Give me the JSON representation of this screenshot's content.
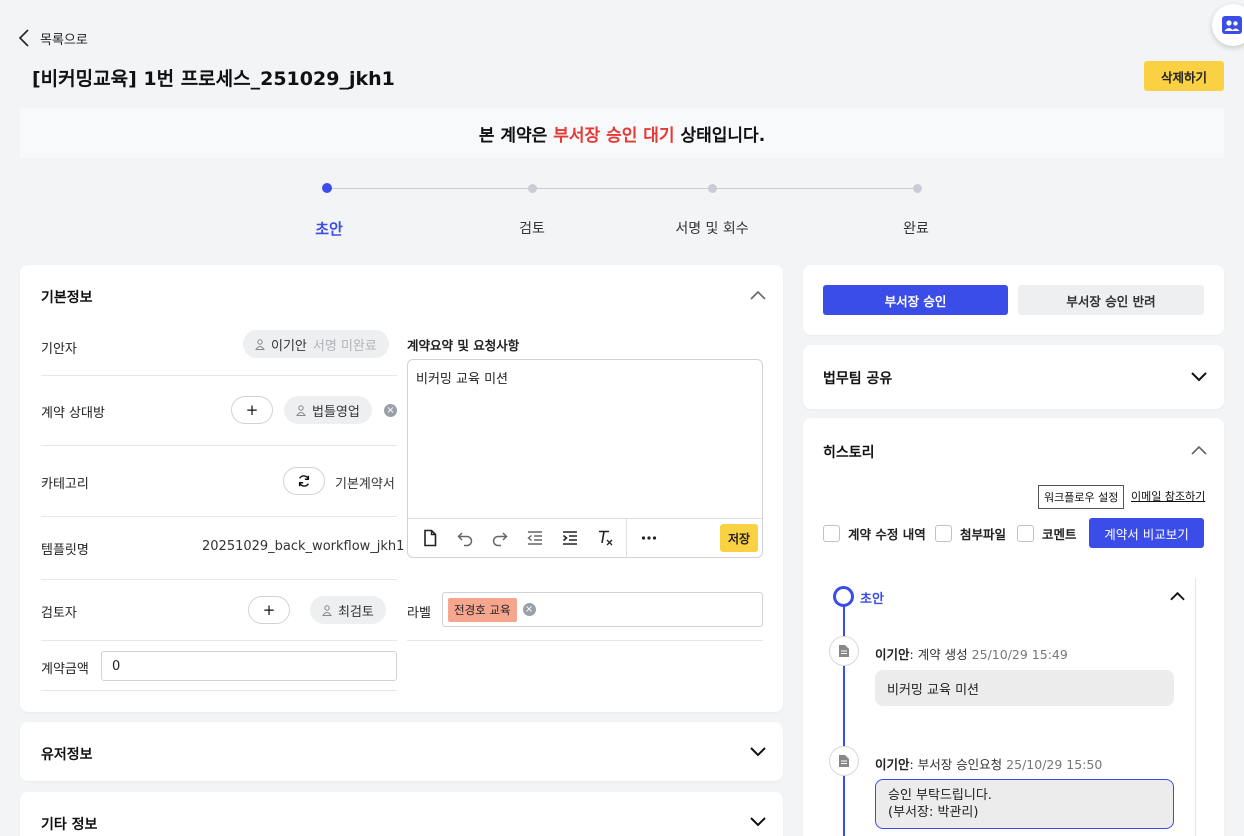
{
  "header": {
    "back_label": "목록으로",
    "title": "[비커밍교육] 1번 프로세스_251029_jkh1",
    "delete_label": "삭제하기"
  },
  "banner": {
    "prefix": "본 계약은 ",
    "status": "부서장 승인 대기",
    "suffix": " 상태입니다."
  },
  "stepper": {
    "steps": [
      {
        "label": "초안",
        "active": true
      },
      {
        "label": "검토",
        "active": false
      },
      {
        "label": "서명 및 회수",
        "active": false
      },
      {
        "label": "완료",
        "active": false
      }
    ]
  },
  "basic_info": {
    "title": "기본정보",
    "drafter_label": "기안자",
    "drafter_name": "이기안",
    "drafter_status": "서명 미완료",
    "counterparty_label": "계약 상대방",
    "counterparty_add": "+",
    "counterparty_name": "법틀영업",
    "category_label": "카테고리",
    "category_value": "기본계약서",
    "template_label": "템플릿명",
    "template_value": "20251029_back_workflow_jkh1",
    "reviewer_label": "검토자",
    "reviewer_add": "+",
    "reviewer_name": "최검토",
    "amount_label": "계약금액",
    "amount_value": "0",
    "summary_label": "계약요약 및 요청사항",
    "summary_value": "비커밍 교육 미션",
    "save_label": "저장",
    "tag_label": "라벨",
    "tag_value": "전경호 교육"
  },
  "user_info": {
    "title": "유저정보"
  },
  "other_info": {
    "title": "기타 정보"
  },
  "approval": {
    "approve_label": "부서장 승인",
    "reject_label": "부서장 승인 반려"
  },
  "legal_share": {
    "title": "법무팀 공유"
  },
  "history": {
    "title": "히스토리",
    "workflow_settings": "워크플로우 설정",
    "email_cc": "이메일 참조하기",
    "filters": [
      "계약 수정 내역",
      "첨부파일",
      "코멘트"
    ],
    "compare_label": "계약서 비교보기",
    "stage_label": "초안",
    "entries": [
      {
        "author": "이기안",
        "action": ": 계약 생성",
        "time": "25/10/29 15:49",
        "message_line1": "비커밍 교육 미션",
        "message_line2": ""
      },
      {
        "author": "이기안",
        "action": ": 부서장 승인요청",
        "time": "25/10/29 15:50",
        "message_line1": "승인 부탁드립니다.",
        "message_line2": "(부서장: 박관리)"
      }
    ]
  },
  "colors": {
    "accent": "#3b4de8",
    "warning": "#fbd144",
    "status_red": "#e53935",
    "tag": "#f6a68e"
  }
}
